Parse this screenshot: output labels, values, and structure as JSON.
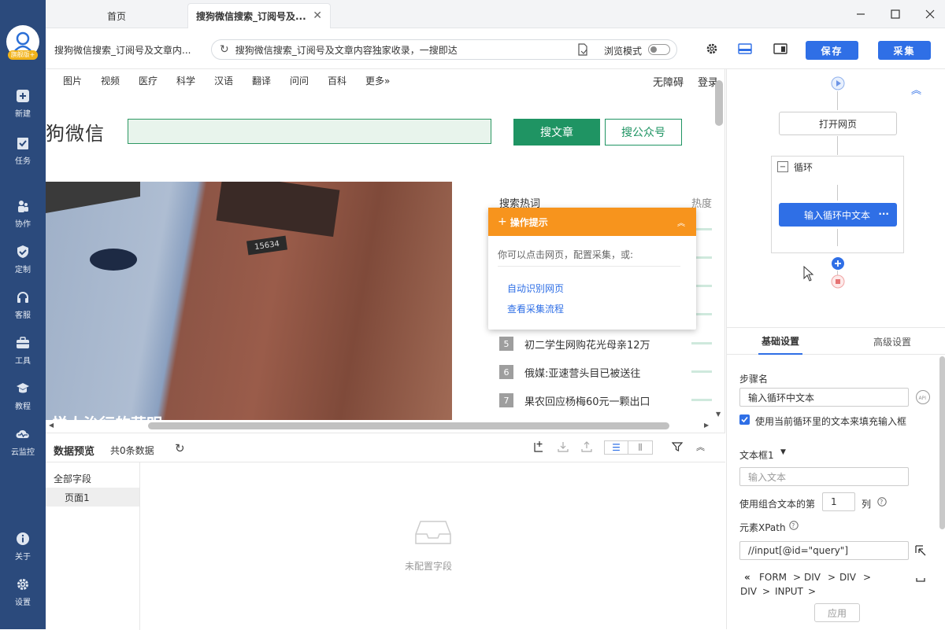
{
  "app": {
    "logo_badge": "旗舰版+",
    "accent": "#2f6fe6",
    "sidebar_color": "#2b4a7c"
  },
  "sidebar": {
    "items": [
      {
        "label": "新建",
        "icon": "plus-square-icon"
      },
      {
        "label": "任务",
        "icon": "task-flag-icon"
      },
      {
        "label": "协作",
        "icon": "people-icon"
      },
      {
        "label": "定制",
        "icon": "shield-check-icon"
      },
      {
        "label": "客服",
        "icon": "headset-icon"
      },
      {
        "label": "工具",
        "icon": "toolbox-icon"
      },
      {
        "label": "教程",
        "icon": "graduation-cap-icon"
      },
      {
        "label": "云监控",
        "icon": "cloud-pulse-icon"
      }
    ],
    "bottom": [
      {
        "label": "关于",
        "icon": "info-icon"
      },
      {
        "label": "设置",
        "icon": "gear-icon"
      }
    ]
  },
  "tabs": [
    {
      "label": "首页"
    },
    {
      "label": "搜狗微信搜索_订阅号及..."
    }
  ],
  "addressbar": {
    "page_title": "搜狗微信搜索_订阅号及文章内...",
    "url": "搜狗微信搜索_订阅号及文章内容独家收录，一搜即达",
    "browse_mode": "浏览模式",
    "save": "保存",
    "collect": "采集"
  },
  "web": {
    "nav": [
      "图片",
      "视频",
      "医疗",
      "科学",
      "汉语",
      "翻译",
      "问问",
      "百科",
      "更多»"
    ],
    "accessibility": "无障碍",
    "login": "登录",
    "logo_text": "狗微信",
    "btn_article": "搜文章",
    "btn_account": "搜公众号",
    "photo_badge": "15634",
    "photo_caption": "悦人治行的荣明",
    "hot_title": "搜索热词",
    "hot_heat": "热度",
    "hot": [
      {
        "rank": "5",
        "text": "初二学生网购花光母亲12万"
      },
      {
        "rank": "6",
        "text": "俄媒:亚速营头目已被送往"
      },
      {
        "rank": "7",
        "text": "果农回应杨梅60元一颗出口"
      }
    ],
    "brand_green": "#1f9463"
  },
  "tip": {
    "title": "操作提示",
    "text": "你可以点击网页，配置采集，或:",
    "link1": "自动识别网页",
    "link2": "查看采集流程",
    "color": "#f7941d"
  },
  "preview": {
    "title": "数据预览",
    "count": "共0条数据",
    "tree_root": "全部字段",
    "tree_child": "页面1",
    "empty": "未配置字段"
  },
  "flow": {
    "open_page": "打开网页",
    "loop": "循环",
    "loop_step": "输入循环中文本"
  },
  "settings": {
    "tab_basic": "基础设置",
    "tab_advanced": "高级设置",
    "step_name_label": "步骤名",
    "step_name": "输入循环中文本",
    "use_loop_text": "使用当前循环里的文本来填充输入框",
    "textbox_label": "文本框1",
    "textbox_placeholder": "输入文本",
    "combo_prefix": "使用组合文本的第",
    "combo_value": "1",
    "combo_suffix": "列",
    "xpath_label": "元素XPath",
    "xpath": "//input[@id=\"query\"]",
    "crumbs": [
      "FORM",
      "DIV",
      "DIV",
      "DIV",
      "INPUT"
    ],
    "apply": "应用"
  }
}
